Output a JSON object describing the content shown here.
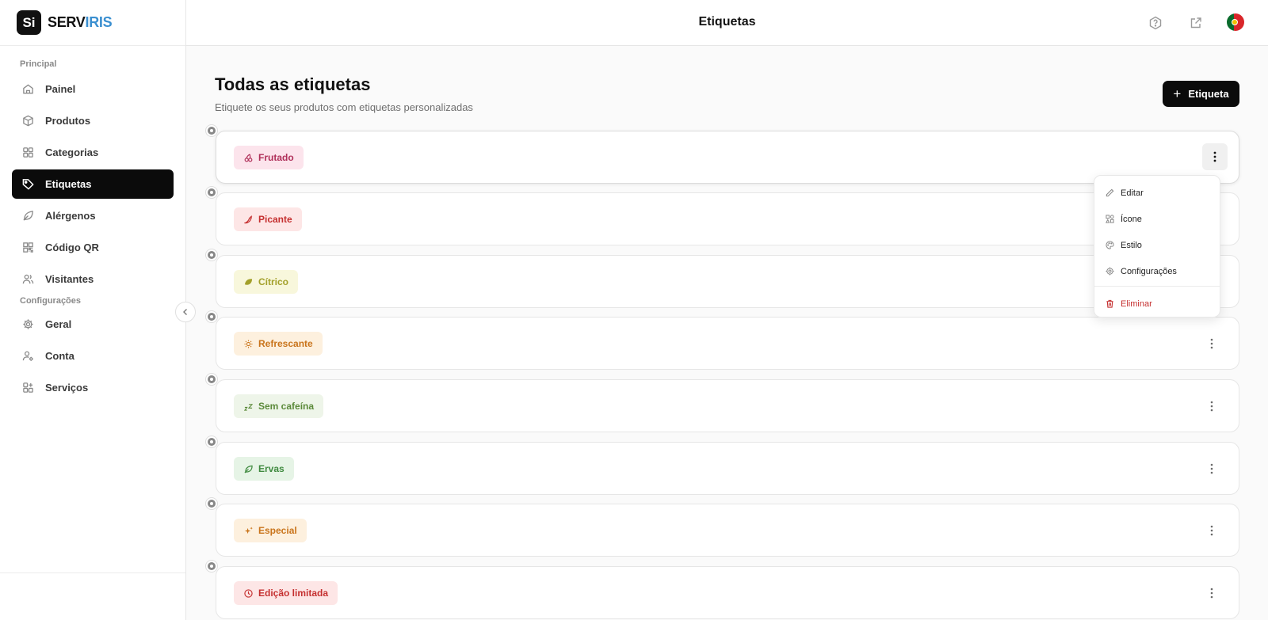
{
  "brand": {
    "logo_text": "Si",
    "name_part1": "SERV",
    "name_part2": "IRIS"
  },
  "header": {
    "title": "Etiquetas"
  },
  "sidebar": {
    "sections": [
      {
        "label": "Principal",
        "items": [
          {
            "label": "Painel",
            "icon": "home-icon"
          },
          {
            "label": "Produtos",
            "icon": "box-icon"
          },
          {
            "label": "Categorias",
            "icon": "grid-icon"
          },
          {
            "label": "Etiquetas",
            "icon": "tag-icon",
            "active": true
          },
          {
            "label": "Alérgenos",
            "icon": "leaf-icon"
          },
          {
            "label": "Código QR",
            "icon": "qr-icon"
          },
          {
            "label": "Visitantes",
            "icon": "users-icon"
          }
        ]
      },
      {
        "label": "Configurações",
        "items": [
          {
            "label": "Geral",
            "icon": "gear-icon"
          },
          {
            "label": "Conta",
            "icon": "user-gear-icon"
          },
          {
            "label": "Serviços",
            "icon": "grid-plus-icon"
          }
        ]
      }
    ]
  },
  "main": {
    "title": "Todas as etiquetas",
    "subtitle": "Etiquete os seus produtos com etiquetas personalizadas",
    "add_button": "Etiqueta"
  },
  "tags": [
    {
      "label": "Frutado",
      "icon": "cherry-icon",
      "bg": "#fce4ec",
      "fg": "#b0305a"
    },
    {
      "label": "Picante",
      "icon": "chili-icon",
      "bg": "#fde6e6",
      "fg": "#c53030"
    },
    {
      "label": "Cítrico",
      "icon": "citrus-icon",
      "bg": "#f8f7dc",
      "fg": "#a3a02a"
    },
    {
      "label": "Refrescante",
      "icon": "sun-icon",
      "bg": "#fdf0de",
      "fg": "#c9741b"
    },
    {
      "label": "Sem cafeína",
      "icon": "zzz-icon",
      "bg": "#eef5e9",
      "fg": "#5b8a3a"
    },
    {
      "label": "Ervas",
      "icon": "herb-icon",
      "bg": "#e6f4e6",
      "fg": "#3f8a3f"
    },
    {
      "label": "Especial",
      "icon": "sparkle-icon",
      "bg": "#fdf0de",
      "fg": "#c9741b"
    },
    {
      "label": "Edição limitada",
      "icon": "clock-icon",
      "bg": "#fde6e6",
      "fg": "#c53030"
    }
  ],
  "menu": {
    "items": [
      {
        "label": "Editar",
        "icon": "pencil-icon"
      },
      {
        "label": "Ícone",
        "icon": "shapes-icon"
      },
      {
        "label": "Estilo",
        "icon": "palette-icon"
      },
      {
        "label": "Configurações",
        "icon": "gear-icon"
      }
    ],
    "danger_item": {
      "label": "Eliminar",
      "icon": "trash-icon"
    }
  }
}
